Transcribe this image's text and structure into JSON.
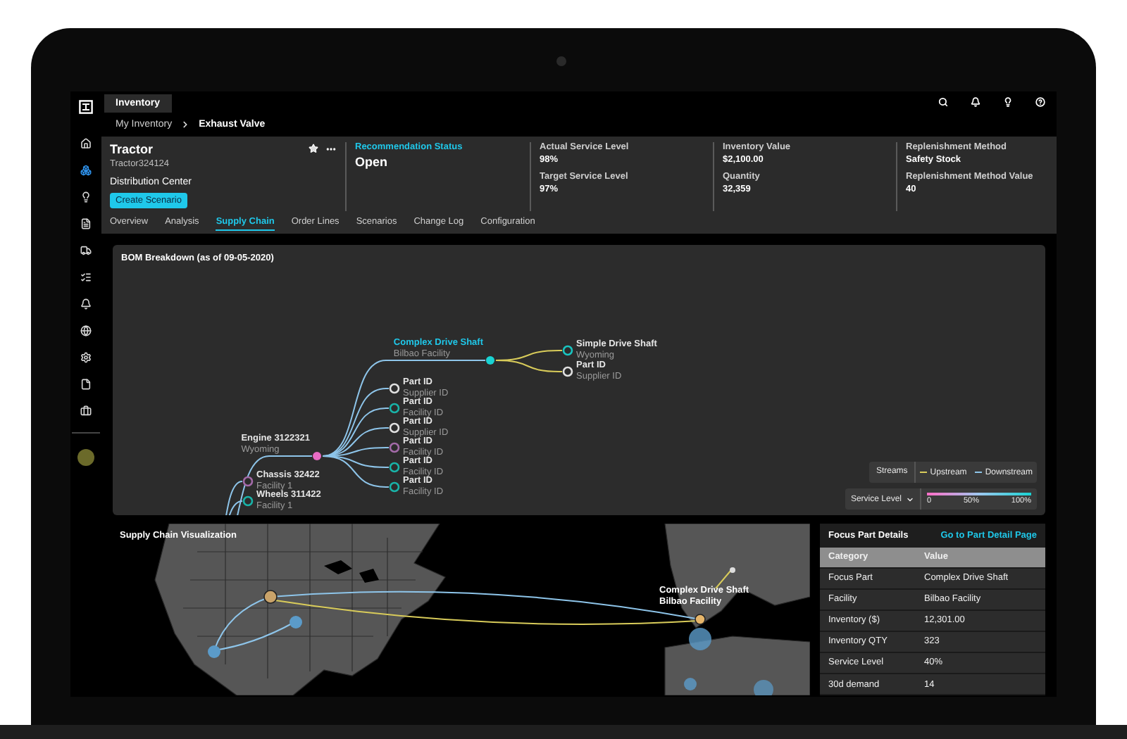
{
  "top_tabs": [
    {
      "label": "Inventory",
      "selected": true
    }
  ],
  "breadcrumb": [
    "My Inventory",
    "Exhaust Valve"
  ],
  "sidebar": {
    "items": [
      {
        "selected": false
      },
      {
        "selected": true
      },
      {
        "selected": false
      },
      {
        "selected": false
      },
      {
        "selected": false
      },
      {
        "selected": false
      },
      {
        "selected": false
      },
      {
        "selected": false
      },
      {
        "selected": false
      },
      {
        "selected": false
      },
      {
        "selected": false
      }
    ]
  },
  "header": {
    "title": "Tractor",
    "subtitle": "Tractor324124",
    "location": "Distribution Center",
    "button": "Create Scenario",
    "status": {
      "label": "Recommendation Status",
      "value": "Open"
    },
    "metrics": [
      [
        {
          "label": "Actual Service Level",
          "value": "98%"
        },
        {
          "label": "Target Service Level",
          "value": "97%"
        }
      ],
      [
        {
          "label": "Inventory Value",
          "value": "$2,100.00"
        },
        {
          "label": "Quantity",
          "value": "32,359"
        }
      ],
      [
        {
          "label": "Replenishment Method",
          "value": "Safety Stock"
        },
        {
          "label": "Replenishment Method Value",
          "value": "40"
        }
      ]
    ]
  },
  "nav_tabs": [
    {
      "label": "Overview",
      "selected": false
    },
    {
      "label": "Analysis",
      "selected": false
    },
    {
      "label": "Supply Chain",
      "selected": true
    },
    {
      "label": "Order Lines",
      "selected": false
    },
    {
      "label": "Scenarios",
      "selected": false
    },
    {
      "label": "Change Log",
      "selected": false
    },
    {
      "label": "Configuration",
      "selected": false
    }
  ],
  "bom": {
    "title": "BOM Breakdown (as of 09-05-2020)",
    "tree": [
      {
        "name": "Engine 3122321",
        "place": "Wyoming",
        "color": "#e86bc4",
        "filled": true,
        "selected": false,
        "upstream": false,
        "children": [
          {
            "name": "Complex Drive Shaft",
            "place": "Bilbao Facility",
            "color": "#19d3d3",
            "filled": true,
            "selected": true,
            "upstream": false,
            "children": [
              {
                "name": "Simple Drive Shaft",
                "place": "Wyoming",
                "color": "#19c4c0",
                "filled": false,
                "selected": false,
                "upstream": true
              },
              {
                "name": "Part ID",
                "place": "Supplier ID",
                "color": "#e0e0e0",
                "filled": false,
                "selected": false,
                "upstream": true
              }
            ]
          },
          {
            "name": "Part ID",
            "place": "Supplier ID",
            "color": "#e0e0e0",
            "filled": false,
            "selected": false,
            "upstream": false
          },
          {
            "name": "Part ID",
            "place": "Facility ID",
            "color": "#19b3a8",
            "filled": false,
            "selected": false,
            "upstream": false
          },
          {
            "name": "Part ID",
            "place": "Supplier ID",
            "color": "#e0e0e0",
            "filled": false,
            "selected": false,
            "upstream": false
          },
          {
            "name": "Part ID",
            "place": "Facility ID",
            "color": "#a36aa8",
            "filled": false,
            "selected": false,
            "upstream": false
          },
          {
            "name": "Part ID",
            "place": "Facility ID",
            "color": "#19b3a8",
            "filled": false,
            "selected": false,
            "upstream": false
          },
          {
            "name": "Part ID",
            "place": "Facility ID",
            "color": "#19b3a8",
            "filled": false,
            "selected": false,
            "upstream": false
          }
        ]
      },
      {
        "name": "Chassis 32422",
        "place": "Facility 1",
        "color": "#a36aa8",
        "filled": false,
        "selected": false,
        "upstream": false
      },
      {
        "name": "Wheels 311422",
        "place": "Facility 1",
        "color": "#19b3a8",
        "filled": false,
        "selected": false,
        "upstream": false
      }
    ],
    "streams": {
      "title": "Streams",
      "items": [
        {
          "label": "Upstream",
          "color": "#d9cc5a"
        },
        {
          "label": "Downstream",
          "color": "#8ec5ea"
        }
      ]
    },
    "service_level": {
      "label": "Service Level",
      "ticks": [
        "0",
        "50%",
        "100%"
      ]
    }
  },
  "map": {
    "title": "Supply Chain Visualization",
    "callout": {
      "name": "Complex Drive Shaft",
      "place": "Bilbao Facility"
    }
  },
  "details": {
    "title": "Focus Part Details",
    "link": "Go to Part Detail Page",
    "columns": [
      "Category",
      "Value"
    ],
    "rows": [
      [
        "Focus Part",
        "Complex Drive Shaft"
      ],
      [
        "Facility",
        "Bilbao Facility"
      ],
      [
        "Inventory ($)",
        "12,301.00"
      ],
      [
        "Inventory QTY",
        "323"
      ],
      [
        "Service Level",
        "40%"
      ],
      [
        "30d demand",
        "14"
      ]
    ]
  }
}
